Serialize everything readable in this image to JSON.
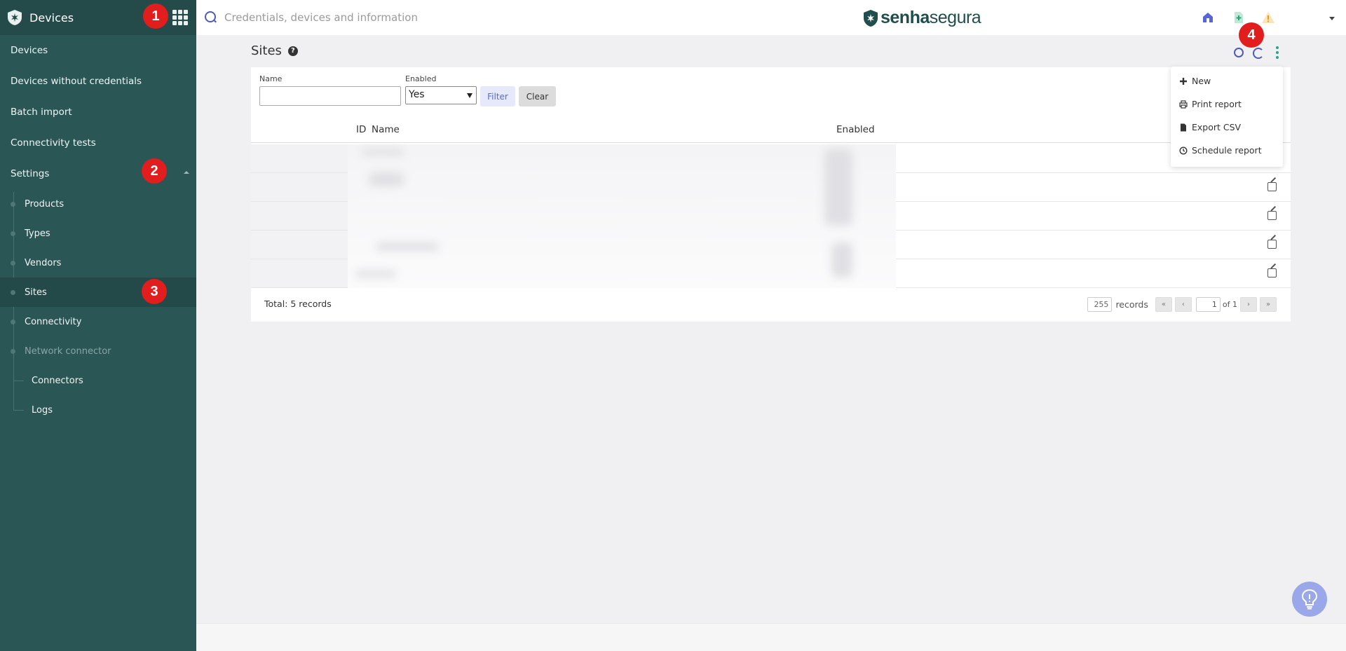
{
  "sidebar": {
    "title": "Devices",
    "items": [
      {
        "label": "Devices"
      },
      {
        "label": "Devices without credentials"
      },
      {
        "label": "Batch import"
      },
      {
        "label": "Connectivity tests"
      },
      {
        "label": "Settings"
      }
    ],
    "settings_children": [
      {
        "label": "Products"
      },
      {
        "label": "Types"
      },
      {
        "label": "Vendors"
      },
      {
        "label": "Sites"
      },
      {
        "label": "Connectivity"
      },
      {
        "label": "Network connector"
      }
    ],
    "network_children": [
      {
        "label": "Connectors"
      },
      {
        "label": "Logs"
      }
    ]
  },
  "topbar": {
    "search_placeholder": "Credentials, devices and information",
    "brand_bold": "senha",
    "brand_light": "segura"
  },
  "page": {
    "title": "Sites"
  },
  "filters": {
    "name_label": "Name",
    "name_value": "",
    "enabled_label": "Enabled",
    "enabled_value": "Yes",
    "filter_button": "Filter",
    "clear_button": "Clear"
  },
  "table": {
    "columns": [
      "ID",
      "Name",
      "Enabled"
    ],
    "total": "Total: 5 records",
    "per_page": "255",
    "records_label": "records",
    "current_page": "1",
    "of_pages": "of 1"
  },
  "menu": {
    "items": [
      {
        "label": "New",
        "icon": "plus-icon"
      },
      {
        "label": "Print report",
        "icon": "print-icon"
      },
      {
        "label": "Export CSV",
        "icon": "file-icon"
      },
      {
        "label": "Schedule report",
        "icon": "clock-icon"
      }
    ]
  },
  "annotations": [
    "1",
    "2",
    "3",
    "4"
  ],
  "colors": {
    "sidebar_bg": "#2a5655",
    "accent_blue": "#4e5ab5",
    "accent_green": "#28a68a",
    "annotation_red": "#e21d1d"
  }
}
